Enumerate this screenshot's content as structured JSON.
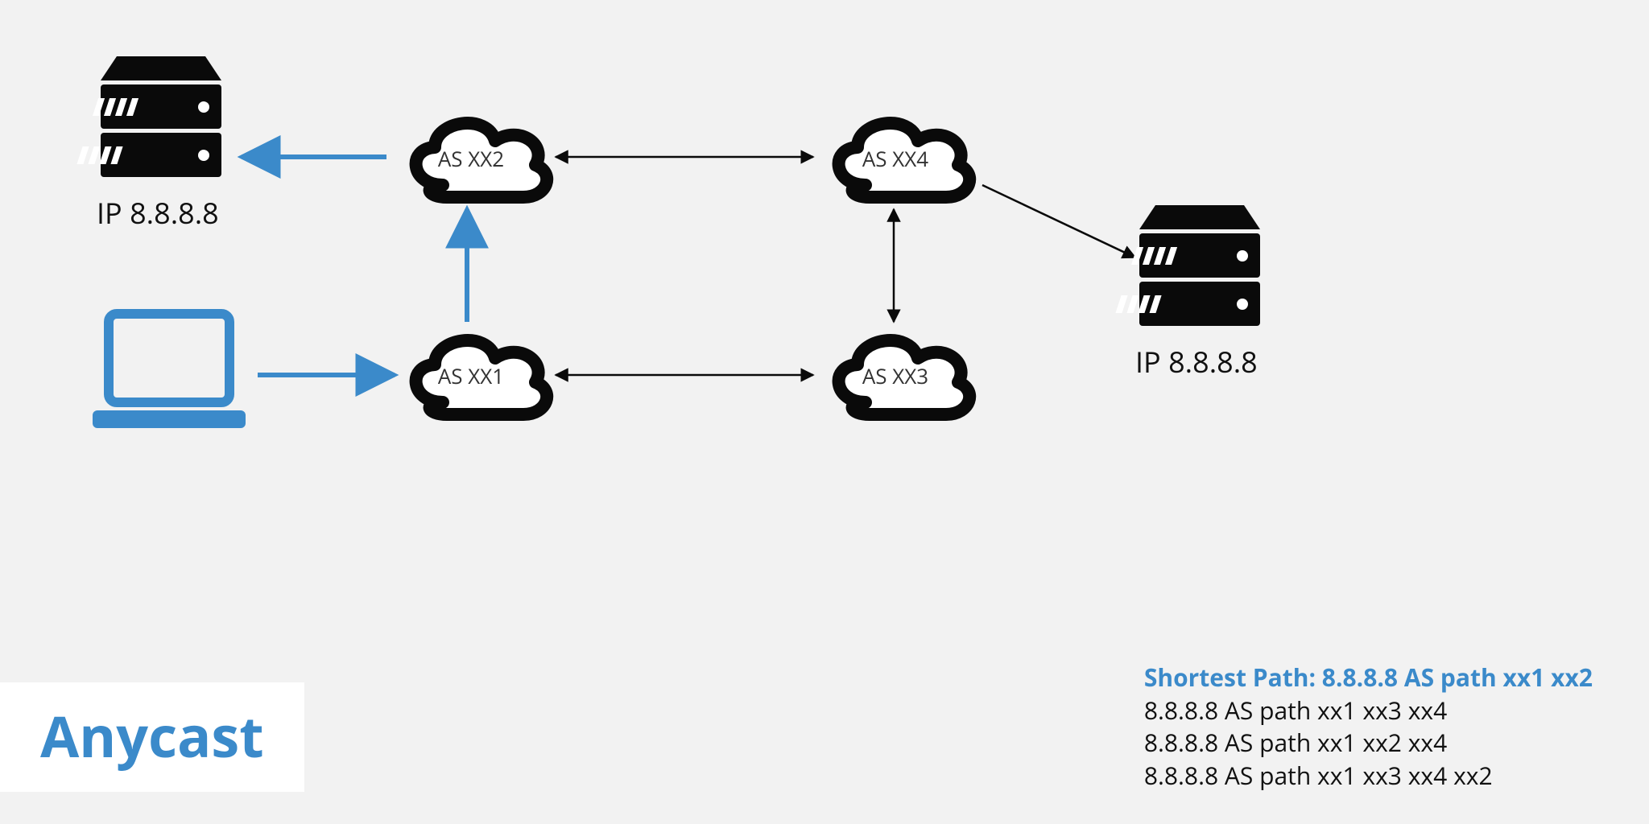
{
  "title": "Anycast",
  "server1_ip": "IP 8.8.8.8",
  "server2_ip": "IP 8.8.8.8",
  "clouds": {
    "xx1": "AS XX1",
    "xx2": "AS XX2",
    "xx3": "AS XX3",
    "xx4": "AS XX4"
  },
  "paths": {
    "shortest_label": "Shortest Path: 8.8.8.8 AS path xx1 xx2",
    "others": [
      "8.8.8.8 AS path xx1 xx3 xx4",
      "8.8.8.8 AS path xx1 xx2 xx4",
      "8.8.8.8 AS path xx1 xx3 xx4 xx2"
    ]
  },
  "colors": {
    "accent": "#3b8aca",
    "ink": "#0a0a0a"
  }
}
